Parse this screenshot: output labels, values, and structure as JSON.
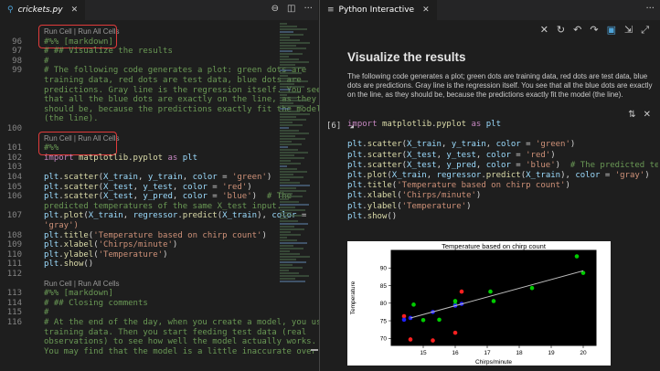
{
  "left": {
    "tab_label": "crickets.py",
    "tab_icon": "python-file-icon",
    "actions": [
      "split-compare-icon",
      "split-editor-icon",
      "more-icon"
    ],
    "codelens": "Run Cell | Run All Cells",
    "lines": [
      {
        "n": "96",
        "text": "#%% [markdown]",
        "cls": "c-comment"
      },
      {
        "n": "97",
        "text": "# ## Visualize the results",
        "cls": "c-comment"
      },
      {
        "n": "98",
        "text": "#",
        "cls": "c-comment"
      },
      {
        "n": "99",
        "text": "# The following code generates a plot: green dots are",
        "cls": "c-comment"
      },
      {
        "n": "",
        "text": "training data, red dots are test data, blue dots are",
        "cls": "c-comment"
      },
      {
        "n": "",
        "text": "predictions. Gray line is the regression itself. You see",
        "cls": "c-comment"
      },
      {
        "n": "",
        "text": "that all the blue dots are exactly on the line, as they",
        "cls": "c-comment"
      },
      {
        "n": "",
        "text": "should be, because the predictions exactly fit the model",
        "cls": "c-comment"
      },
      {
        "n": "",
        "text": "(the line).",
        "cls": "c-comment"
      },
      {
        "n": "100",
        "text": "",
        "cls": ""
      },
      {
        "n": "101",
        "text": "#%%",
        "cls": "c-comment"
      },
      {
        "n": "102",
        "text": "import matplotlib.pyplot as plt",
        "cls": "code-import"
      },
      {
        "n": "103",
        "text": "",
        "cls": ""
      },
      {
        "n": "104",
        "text": "plt.scatter(X_train, y_train, color = 'green')",
        "cls": "code"
      },
      {
        "n": "105",
        "text": "plt.scatter(X_test, y_test, color = 'red')",
        "cls": "code"
      },
      {
        "n": "106",
        "text": "plt.scatter(X_test, y_pred, color = 'blue')  # The",
        "cls": "code"
      },
      {
        "n": "",
        "text": "predicted temperatures of the same X_test input.",
        "cls": "c-comment"
      },
      {
        "n": "107",
        "text": "plt.plot(X_train, regressor.predict(X_train), color =",
        "cls": "code"
      },
      {
        "n": "",
        "text": "'gray')",
        "cls": "c-str"
      },
      {
        "n": "108",
        "text": "plt.title('Temperature based on chirp count')",
        "cls": "code"
      },
      {
        "n": "109",
        "text": "plt.xlabel('Chirps/minute')",
        "cls": "code"
      },
      {
        "n": "110",
        "text": "plt.ylabel('Temperature')",
        "cls": "code"
      },
      {
        "n": "111",
        "text": "plt.show()",
        "cls": "code"
      },
      {
        "n": "112",
        "text": "",
        "cls": ""
      },
      {
        "n": "113",
        "text": "#%% [markdown]",
        "cls": "c-comment"
      },
      {
        "n": "114",
        "text": "# ## Closing comments",
        "cls": "c-comment"
      },
      {
        "n": "115",
        "text": "#",
        "cls": "c-comment"
      },
      {
        "n": "116",
        "text": "# At the end of the day, when you create a model, you use",
        "cls": "c-comment"
      },
      {
        "n": "",
        "text": "training data. Then you start feeding test data (real",
        "cls": "c-comment"
      },
      {
        "n": "",
        "text": "observations) to see how well the model actually works.",
        "cls": "c-comment"
      },
      {
        "n": "",
        "text": "You may find that the model is a little inaccurate over",
        "cls": "c-comment"
      }
    ]
  },
  "right": {
    "tab_label": "Python Interactive",
    "toolbar_icons": [
      "close-icon",
      "undo-icon",
      "redo-icon",
      "restart-icon",
      "save-icon",
      "export-icon",
      "collapse-icon"
    ],
    "md_title": "Visualize the results",
    "md_para": "The following code generates a plot; green dots are training data, red dots are test data, blue dots are predictions. Gray line is the regression itself. You see that all the blue dots are exactly on the line, as they should be, because the predictions exactly fit the model (the line).",
    "exec_count": "[6]",
    "cell_lines": [
      "import matplotlib.pyplot as plt",
      "",
      "plt.scatter(X_train, y_train, color = 'green')",
      "plt.scatter(X_test, y_test, color = 'red')",
      "plt.scatter(X_test, y_pred, color = 'blue')  # The predicted temperatures of",
      "plt.plot(X_train, regressor.predict(X_train), color = 'gray')",
      "plt.title('Temperature based on chirp count')",
      "plt.xlabel('Chirps/minute')",
      "plt.ylabel('Temperature')",
      "plt.show()"
    ]
  },
  "chart_data": {
    "type": "scatter",
    "title": "Temperature based on chirp count",
    "xlabel": "Chirps/minute",
    "ylabel": "Temperature",
    "xlim": [
      14.0,
      20.4
    ],
    "ylim": [
      68,
      95
    ],
    "xticks": [
      15,
      16,
      17,
      18,
      19,
      20
    ],
    "yticks": [
      70,
      75,
      80,
      85,
      90
    ],
    "colors": {
      "train": "#00cc00",
      "test": "#ff2020",
      "pred": "#2020ff",
      "line": "#bdbdbd",
      "bg": "#000000"
    },
    "series": [
      {
        "name": "green",
        "values": [
          [
            14.7,
            79.6
          ],
          [
            15.0,
            75.2
          ],
          [
            15.5,
            75.3
          ],
          [
            16.0,
            80.6
          ],
          [
            16.0,
            79.6
          ],
          [
            17.1,
            83.3
          ],
          [
            17.2,
            80.6
          ],
          [
            18.4,
            84.3
          ],
          [
            19.8,
            93.3
          ],
          [
            20.0,
            88.6
          ]
        ]
      },
      {
        "name": "red",
        "values": [
          [
            14.4,
            76.3
          ],
          [
            14.6,
            69.7
          ],
          [
            15.3,
            69.4
          ],
          [
            16.0,
            71.6
          ],
          [
            16.2,
            83.3
          ]
        ]
      },
      {
        "name": "blue",
        "values": [
          [
            14.4,
            75.3
          ],
          [
            14.6,
            75.8
          ],
          [
            15.3,
            77.5
          ],
          [
            16.0,
            79.3
          ],
          [
            16.2,
            79.8
          ]
        ]
      },
      {
        "name": "gray",
        "values": [
          [
            14.6,
            75.8
          ],
          [
            20.0,
            89.2
          ]
        ]
      }
    ]
  }
}
